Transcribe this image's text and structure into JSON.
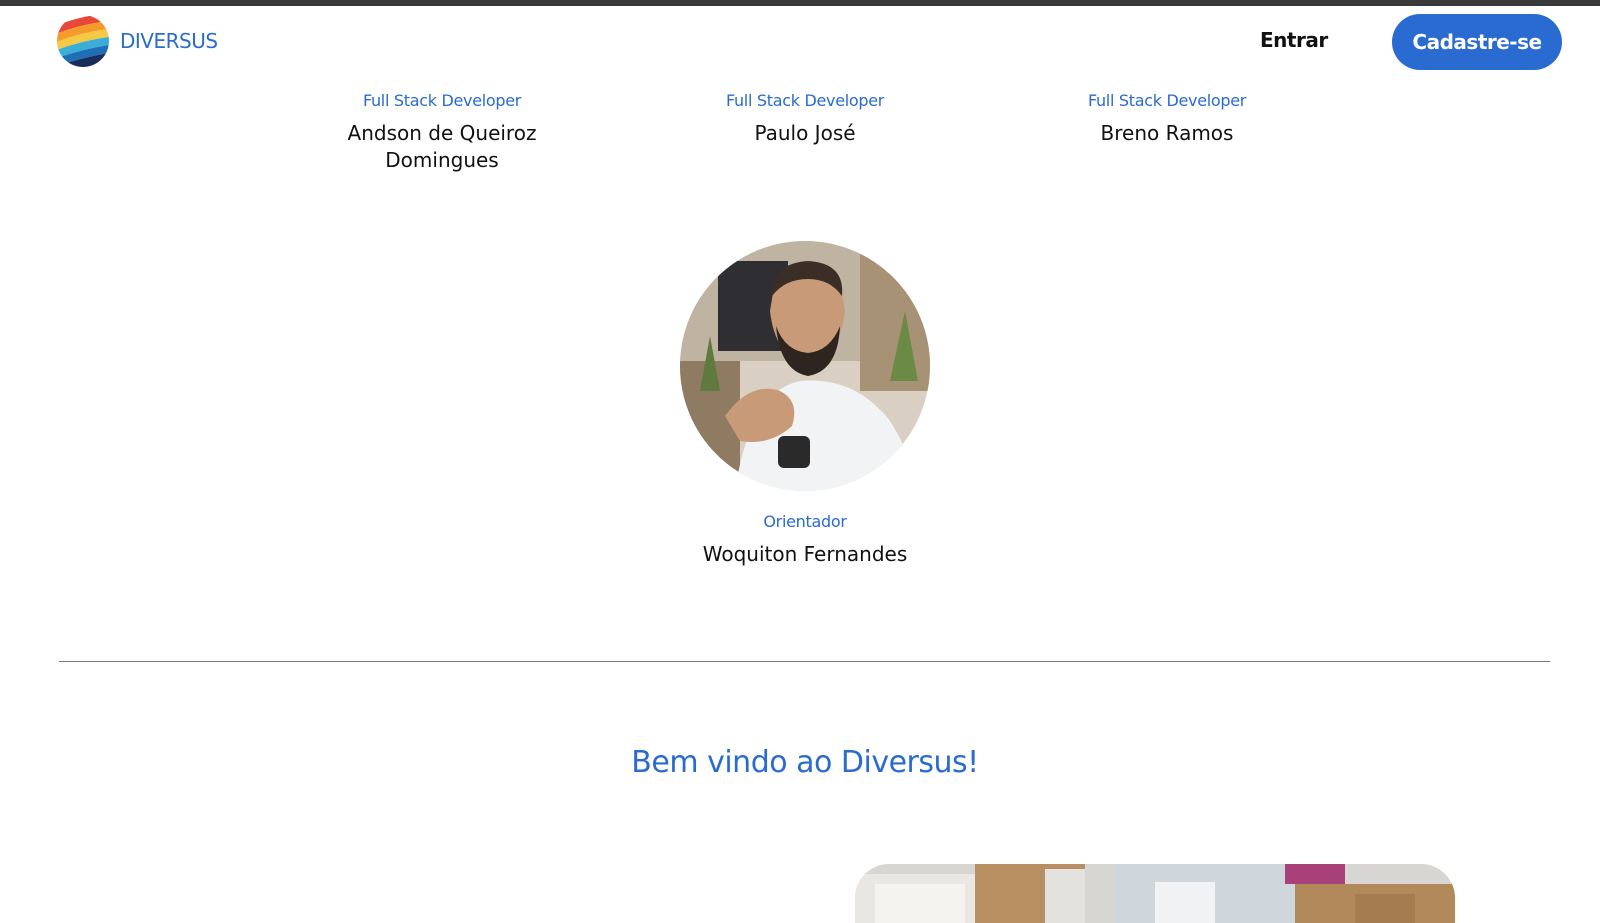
{
  "header": {
    "brand_name": "DIVERSUS",
    "login_label": "Entrar",
    "signup_label": "Cadastre-se"
  },
  "team": {
    "members": [
      {
        "role": "Full Stack Developer",
        "name": "Andson de Queiroz Domingues"
      },
      {
        "role": "Full Stack Developer",
        "name": "Paulo José"
      },
      {
        "role": "Full Stack Developer",
        "name": "Breno Ramos"
      }
    ],
    "advisor": {
      "role": "Orientador",
      "name": "Woquiton Fernandes"
    }
  },
  "welcome": {
    "title": "Bem vindo ao Diversus!"
  },
  "colors": {
    "accent": "#2a6bd1",
    "text": "#111111",
    "background": "#ffffff"
  }
}
